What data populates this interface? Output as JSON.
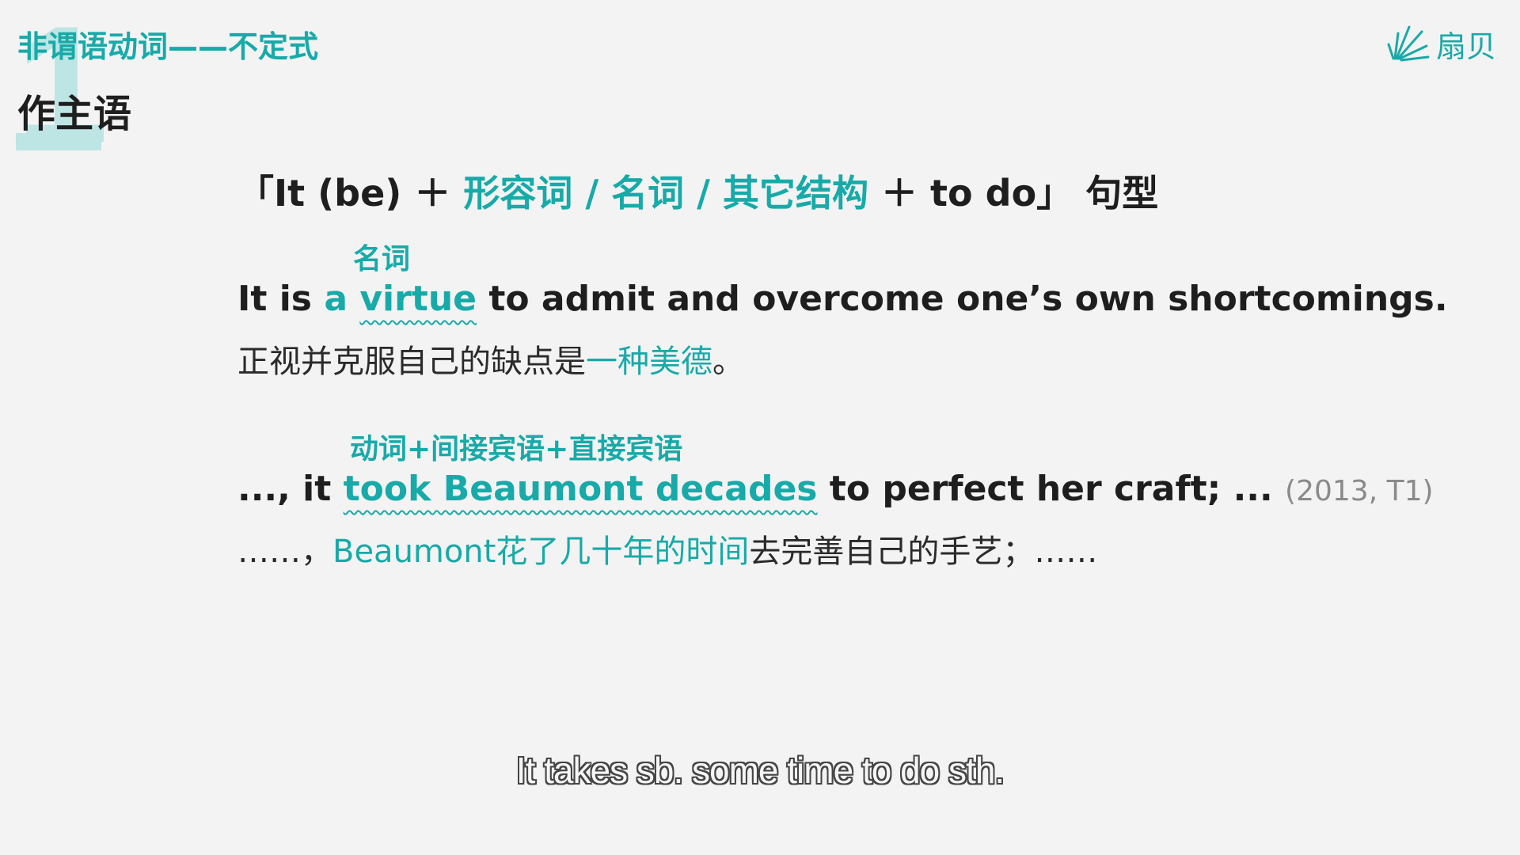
{
  "header": {
    "section_number": "1",
    "section_title": "非谓语动词——不定式",
    "subsection_title": "作主语"
  },
  "logo": {
    "icon": "fan-shell-icon",
    "text": "扇贝"
  },
  "pattern": {
    "open": "「It (be)",
    "plus1": "＋",
    "options": "形容词 / 名词 / 其它结构",
    "plus2": "＋",
    "tail": "to do」",
    "suffix": "句型"
  },
  "example1": {
    "annotation": "名词",
    "en_before": "It is ",
    "en_a": "a ",
    "en_highlight": "virtue",
    "en_after": " to admit and overcome one’s own shortcomings.",
    "zh_before": "正视并克服自己的缺点是",
    "zh_highlight": "一种美德",
    "zh_after": "。"
  },
  "example2": {
    "annotation": "动词+间接宾语+直接宾语",
    "en_before": "..., it ",
    "en_highlight": "took Beaumont decades",
    "en_after": " to perfect her craft; ... ",
    "source": "(2013, T1)",
    "zh_before": "……，",
    "zh_highlight": "Beaumont花了几十年的时间",
    "zh_after": "去完善自己的手艺；……"
  },
  "subtitle": "It takes sb. some time to do sth.",
  "colors": {
    "accent": "#17aaa8",
    "accent_light": "#bde5e4",
    "text": "#1e1e1e",
    "background": "#f3f3f3"
  }
}
